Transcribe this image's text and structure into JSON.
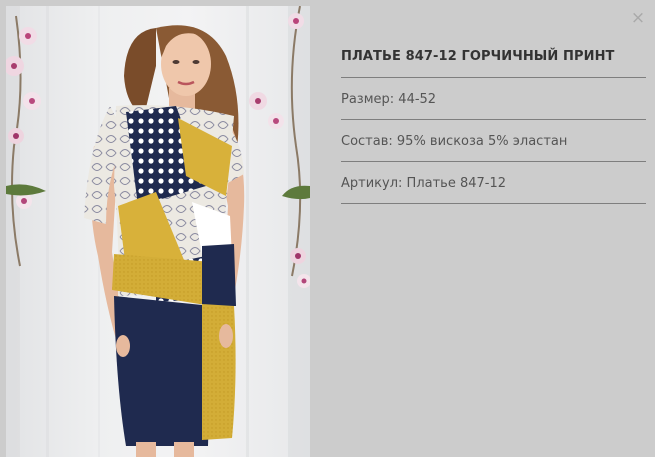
{
  "product": {
    "title": "ПЛАТЬЕ 847-12 ГОРЧИЧНЫЙ ПРИНТ",
    "image_alt": "Платье 847-12 горчичный принт"
  },
  "specs": [
    {
      "label": "Размер:",
      "value": "44-52"
    },
    {
      "label": "Состав:",
      "value": "95% вискоза 5% эластан"
    },
    {
      "label": "Артикул:",
      "value": "Платье 847-12"
    }
  ],
  "close_icon": {
    "glyph": "×"
  },
  "colors": {
    "background": "#cccccc",
    "mustard": "#d8b13a",
    "navy": "#1f2a4f"
  }
}
